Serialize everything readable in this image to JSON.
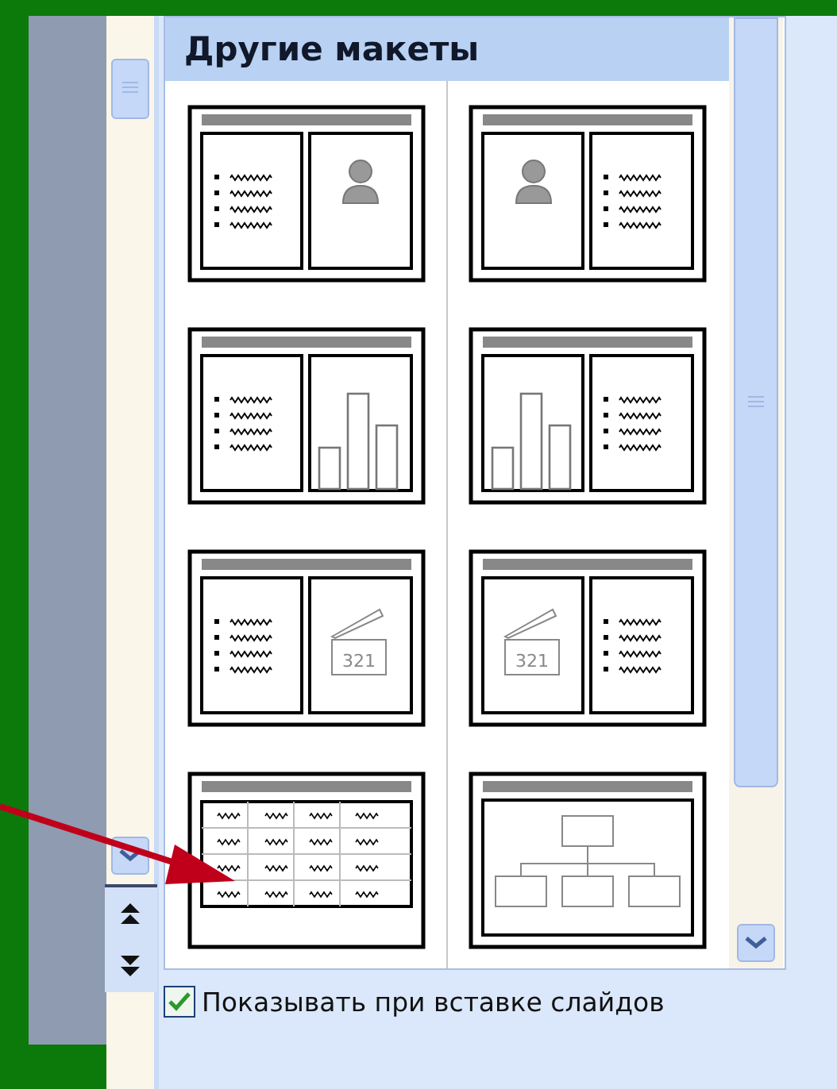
{
  "panel": {
    "title": "Другие макеты"
  },
  "layouts": [
    {
      "kind": "text-picture"
    },
    {
      "kind": "picture-text"
    },
    {
      "kind": "text-chart"
    },
    {
      "kind": "chart-text"
    },
    {
      "kind": "text-media",
      "media_label": "321"
    },
    {
      "kind": "media-text",
      "media_label": "321"
    },
    {
      "kind": "table"
    },
    {
      "kind": "org-chart"
    }
  ],
  "option": {
    "label": "Показывать при вставке слайдов",
    "checked": true
  }
}
